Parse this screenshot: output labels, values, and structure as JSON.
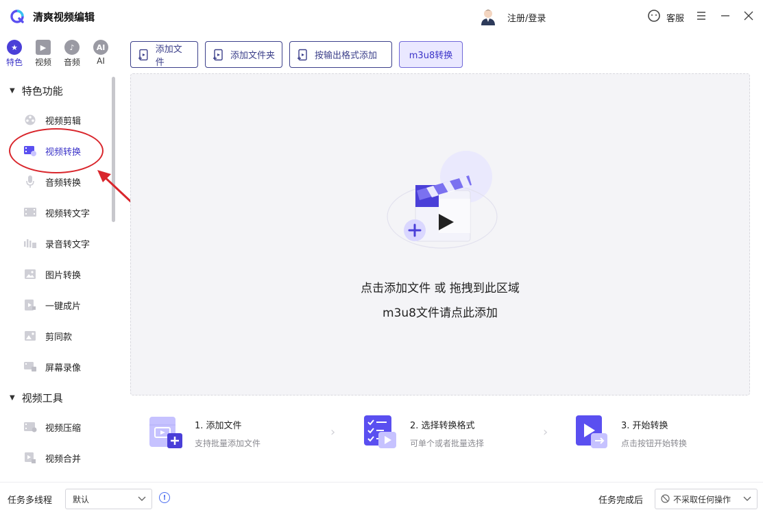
{
  "app": {
    "title": "清爽视频编辑"
  },
  "header": {
    "login": "注册/登录",
    "service": "客服"
  },
  "category_tabs": [
    {
      "label": "特色",
      "icon": "star-icon",
      "active": true
    },
    {
      "label": "视频",
      "icon": "film-icon",
      "active": false
    },
    {
      "label": "音频",
      "icon": "music-note-icon",
      "active": false
    },
    {
      "label": "AI",
      "icon": "ai-icon",
      "active": false
    }
  ],
  "sidebar": {
    "section1": "特色功能",
    "items1": [
      {
        "label": "视频剪辑",
        "icon": "film-reel-icon"
      },
      {
        "label": "视频转换",
        "icon": "video-convert-icon",
        "active": true
      },
      {
        "label": "音频转换",
        "icon": "microphone-icon"
      },
      {
        "label": "视频转文字",
        "icon": "video-text-icon"
      },
      {
        "label": "录音转文字",
        "icon": "audio-text-icon"
      },
      {
        "label": "图片转换",
        "icon": "image-icon"
      },
      {
        "label": "一键成片",
        "icon": "play-icon"
      },
      {
        "label": "剪同款",
        "icon": "template-icon"
      },
      {
        "label": "屏幕录像",
        "icon": "screen-record-icon"
      }
    ],
    "section2": "视频工具",
    "items2": [
      {
        "label": "视频压缩",
        "icon": "compress-icon"
      },
      {
        "label": "视频合并",
        "icon": "merge-icon"
      }
    ]
  },
  "toolbar": {
    "add_file": "添加文件",
    "add_folder": "添加文件夹",
    "add_by_format": "按输出格式添加",
    "m3u8": "m3u8转换"
  },
  "dropzone": {
    "line1": "点击添加文件 或 拖拽到此区域",
    "line2": "m3u8文件请点此添加"
  },
  "steps": [
    {
      "title": "1. 添加文件",
      "desc": "支持批量添加文件"
    },
    {
      "title": "2. 选择转换格式",
      "desc": "可单个或者批量选择"
    },
    {
      "title": "3. 开始转换",
      "desc": "点击按钮开始转换"
    }
  ],
  "bottom": {
    "multithread_label": "任务多线程",
    "multithread_value": "默认",
    "after_label": "任务完成后",
    "after_value": "不采取任何操作"
  },
  "colors": {
    "accent": "#4a3fd8",
    "annotation": "#d9262c"
  }
}
